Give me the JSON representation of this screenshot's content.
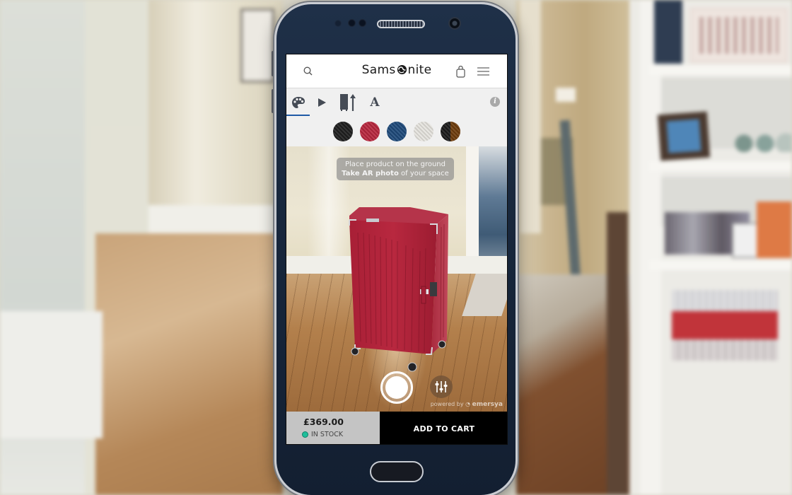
{
  "header": {
    "brand": "Samsonite",
    "brand_prefix": "Sams",
    "brand_suffix": "nite",
    "search_icon": "search-icon",
    "bag_icon": "shopping-bag-icon",
    "menu_icon": "hamburger-menu-icon"
  },
  "toolbar": {
    "tools": [
      {
        "name": "palette",
        "icon": "palette-icon",
        "active": true
      },
      {
        "name": "video",
        "icon": "play-icon",
        "active": false
      },
      {
        "name": "dimensions",
        "icon": "size-height-icon",
        "active": false
      },
      {
        "name": "personalize",
        "icon": "text-icon",
        "label": "A",
        "active": false
      }
    ],
    "info_icon": "info-icon",
    "info_label": "i",
    "accent_color": "#1f5aa6"
  },
  "swatches": [
    {
      "name": "black",
      "color": "#1e1e1e",
      "selected": false
    },
    {
      "name": "red",
      "color": "#b8263d",
      "selected": true
    },
    {
      "name": "navy",
      "color": "#1e4a7a",
      "selected": false
    },
    {
      "name": "white",
      "color": "#e6e4df",
      "selected": false
    },
    {
      "name": "black-brown",
      "color_left": "#1b1b1b",
      "color_right": "#6e3c0c",
      "selected": false
    }
  ],
  "ar_view": {
    "hint_line1": "Place product on the ground",
    "hint_bold": "Take AR photo",
    "hint_rest": " of your space",
    "powered_prefix": "powered by ",
    "powered_brand": "emersya",
    "shutter_icon": "camera-shutter-icon",
    "adjust_icon": "sliders-icon",
    "product_color": "#b1243a"
  },
  "purchase": {
    "price": "£369.00",
    "stock_status": "IN STOCK",
    "stock_color": "#1fbf9a",
    "add_to_cart": "ADD TO CART"
  }
}
